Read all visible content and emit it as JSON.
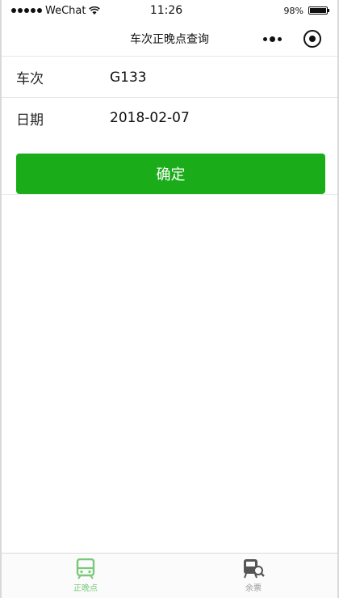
{
  "status_bar": {
    "carrier": "WeChat",
    "time": "11:26",
    "battery": "98%",
    "battery_level": 0.98
  },
  "nav": {
    "title": "车次正晚点查询"
  },
  "form": {
    "train_label": "车次",
    "train_value": "G133",
    "date_label": "日期",
    "date_value": "2018-02-07"
  },
  "confirm_label": "确定",
  "tabs": [
    {
      "label": "正晚点",
      "icon": "train-icon",
      "active": true
    },
    {
      "label": "余票",
      "icon": "ticket-search-icon",
      "active": false
    }
  ],
  "colors": {
    "primary": "#1aad19",
    "tab_active": "#7ac97a",
    "tab_inactive": "#999999"
  }
}
